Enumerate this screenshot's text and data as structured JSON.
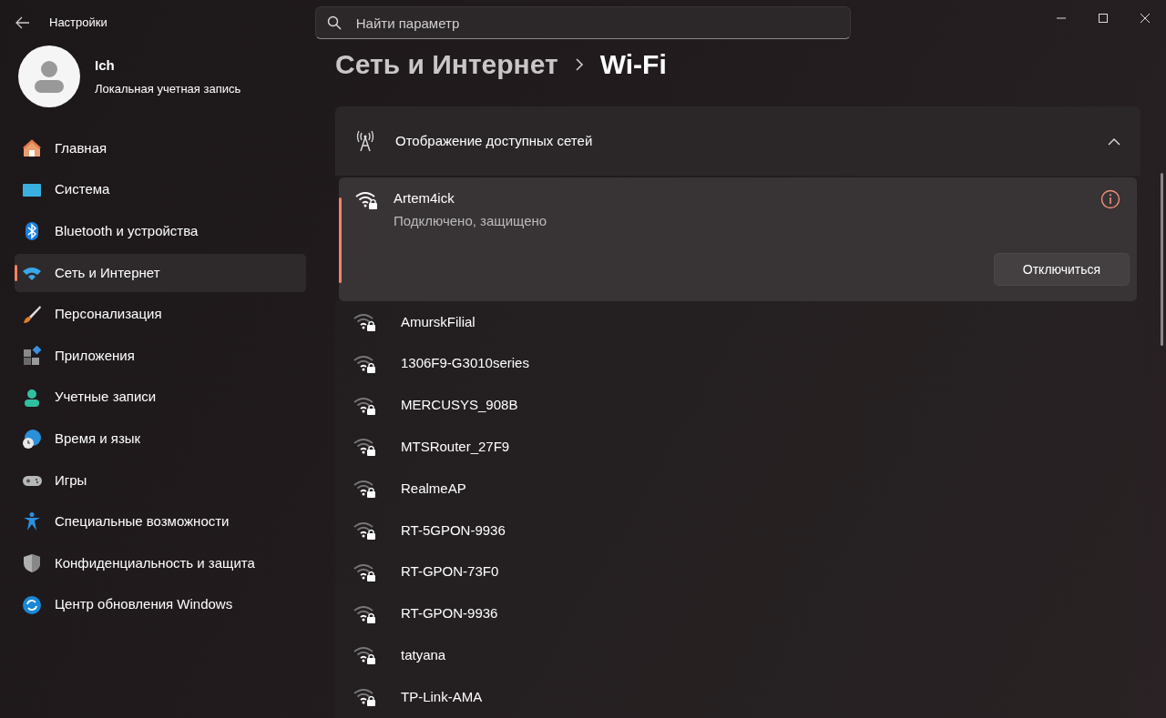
{
  "window": {
    "title": "Настройки"
  },
  "search": {
    "placeholder": "Найти параметр"
  },
  "user": {
    "name": "Ich",
    "account": "Локальная учетная запись"
  },
  "sidebar": {
    "items": [
      {
        "label": "Главная",
        "kind": "home",
        "selected": false
      },
      {
        "label": "Система",
        "kind": "system",
        "selected": false
      },
      {
        "label": "Bluetooth и устройства",
        "kind": "bluetooth",
        "selected": false
      },
      {
        "label": "Сеть и Интернет",
        "kind": "network",
        "selected": true
      },
      {
        "label": "Персонализация",
        "kind": "brush",
        "selected": false
      },
      {
        "label": "Приложения",
        "kind": "apps",
        "selected": false
      },
      {
        "label": "Учетные записи",
        "kind": "accounts",
        "selected": false
      },
      {
        "label": "Время и язык",
        "kind": "time",
        "selected": false
      },
      {
        "label": "Игры",
        "kind": "games",
        "selected": false
      },
      {
        "label": "Специальные возможности",
        "kind": "access",
        "selected": false
      },
      {
        "label": "Конфиденциальность и защита",
        "kind": "shield",
        "selected": false
      },
      {
        "label": "Центр обновления Windows",
        "kind": "update",
        "selected": false
      }
    ]
  },
  "breadcrumb": [
    "Сеть и Интернет",
    "Wi-Fi"
  ],
  "networks_panel": {
    "title": "Отображение доступных сетей",
    "expanded": true,
    "connected": {
      "name": "Artem4ick",
      "status": "Подключено, защищено",
      "button": "Отключиться"
    },
    "networks": [
      "AmurskFilial",
      "1306F9-G3010series",
      "MERCUSYS_908B",
      "MTSRouter_27F9",
      "RealmeAP",
      "RT-5GPON-9936",
      "RT-GPON-73F0",
      "RT-GPON-9936",
      "tatyana",
      "TP-Link-AMA"
    ]
  }
}
